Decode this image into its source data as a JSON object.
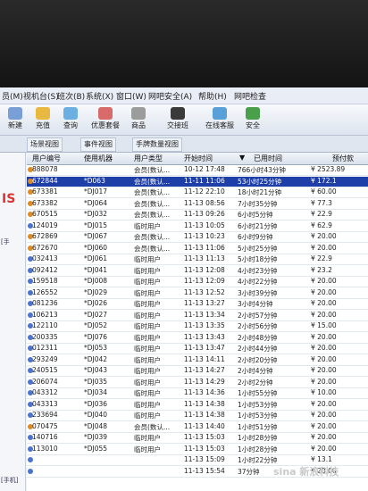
{
  "menu": [
    "员(M)",
    "视机台(S)",
    "班次(B)",
    "系统(X)",
    "窗口(W)",
    "网吧安全(A)",
    "帮助(H)",
    "网吧检查"
  ],
  "toolbar": [
    "新建",
    "充值",
    "查询",
    "优惠套餐",
    "商品",
    "交接班",
    "在线客服",
    "安全"
  ],
  "tabs": [
    "场景视图",
    "事件视图",
    "手牌数量视图"
  ],
  "left_panel": {
    "brand": "IS",
    "label1": "[手",
    "label2": "[手机]"
  },
  "columns": [
    "用户编号",
    "使用机器",
    "用户类型",
    "开始时间",
    "已用时间",
    "预付款"
  ],
  "rows": [
    [
      "888078",
      "",
      "会员(数认...",
      "10-12 17:48",
      "766小时43分钟",
      "¥ 2523.89"
    ],
    [
      "672844",
      "*D063",
      "会员(数认...",
      "11-11 11:06",
      "53小时25分钟",
      "¥ 172.1"
    ],
    [
      "673381",
      "*DJ017",
      "会员(数认...",
      "11-12 22:10",
      "18小时21分钟",
      "¥ 60.00"
    ],
    [
      "673382",
      "*DJ064",
      "会员(数认...",
      "11-13 08:56",
      "7小时35分钟",
      "¥ 77.3"
    ],
    [
      "670515",
      "*DJ032",
      "会员(数认...",
      "11-13 09:26",
      "6小时5分钟",
      "¥ 22.9"
    ],
    [
      "124019",
      "*DJ015",
      "临时用户",
      "11-13 10:05",
      "6小时21分钟",
      "¥ 62.9"
    ],
    [
      "672869",
      "*DJ067",
      "会员(数认...",
      "11-13 10:23",
      "6小时9分钟",
      "¥ 20.00"
    ],
    [
      "672670",
      "*DJ060",
      "会员(数认...",
      "11-13 11:06",
      "5小时25分钟",
      "¥ 20.00"
    ],
    [
      "032413",
      "*DJ061",
      "临时用户",
      "11-13 11:13",
      "5小时18分钟",
      "¥ 22.9"
    ],
    [
      "092412",
      "*DJ041",
      "临时用户",
      "11-13 12:08",
      "4小时23分钟",
      "¥ 23.2"
    ],
    [
      "159518",
      "*DJ008",
      "临时用户",
      "11-13 12:09",
      "4小时22分钟",
      "¥ 20.00"
    ],
    [
      "126552",
      "*DJ029",
      "临时用户",
      "11-13 12:52",
      "3小时39分钟",
      "¥ 20.00"
    ],
    [
      "081236",
      "*DJ026",
      "临时用户",
      "11-13 13:27",
      "3小时4分钟",
      "¥ 20.00"
    ],
    [
      "106213",
      "*DJ027",
      "临时用户",
      "11-13 13:34",
      "2小时57分钟",
      "¥ 20.00"
    ],
    [
      "122110",
      "*DJ052",
      "临时用户",
      "11-13 13:35",
      "2小时56分钟",
      "¥ 15.00"
    ],
    [
      "200335",
      "*DJ076",
      "临时用户",
      "11-13 13:43",
      "2小时48分钟",
      "¥ 20.00"
    ],
    [
      "012311",
      "*DJ053",
      "临时用户",
      "11-13 13:47",
      "2小时44分钟",
      "¥ 20.00"
    ],
    [
      "293249",
      "*DJ042",
      "临时用户",
      "11-13 14:11",
      "2小时20分钟",
      "¥ 20.00"
    ],
    [
      "240515",
      "*DJ043",
      "临时用户",
      "11-13 14:27",
      "2小时4分钟",
      "¥ 20.00"
    ],
    [
      "206074",
      "*DJ035",
      "临时用户",
      "11-13 14:29",
      "2小时2分钟",
      "¥ 20.00"
    ],
    [
      "043312",
      "*DJ034",
      "临时用户",
      "11-13 14:36",
      "1小时55分钟",
      "¥ 10.00"
    ],
    [
      "043313",
      "*DJ036",
      "临时用户",
      "11-13 14:38",
      "1小时53分钟",
      "¥ 20.00"
    ],
    [
      "233694",
      "*DJ040",
      "临时用户",
      "11-13 14:38",
      "1小时53分钟",
      "¥ 20.00"
    ],
    [
      "070475",
      "*DJ048",
      "会员(数认...",
      "11-13 14:40",
      "1小时51分钟",
      "¥ 20.00"
    ],
    [
      "140716",
      "*DJ039",
      "临时用户",
      "11-13 15:03",
      "1小时28分钟",
      "¥ 20.00"
    ],
    [
      "113010",
      "*DJ055",
      "临时用户",
      "11-13 15:03",
      "1小时28分钟",
      "¥ 20.00"
    ],
    [
      "",
      "",
      "",
      "11-13 15:09",
      "1小时22分钟",
      "¥ 13.1"
    ],
    [
      "",
      "",
      "",
      "11-13 15:54",
      "37分钟",
      "¥ 20.00"
    ]
  ],
  "watermark": "sina 新浪科技"
}
